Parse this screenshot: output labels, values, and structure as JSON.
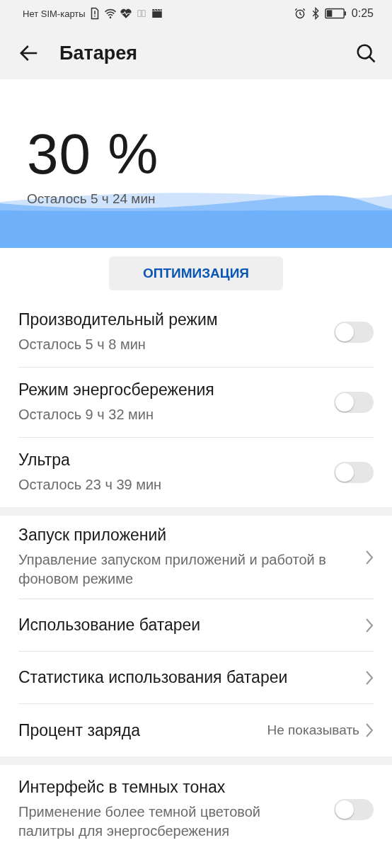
{
  "status_bar": {
    "carrier": "Нет SIM-карты",
    "time": "0:25"
  },
  "app_bar": {
    "title": "Батарея"
  },
  "battery": {
    "percent": "30 %",
    "remaining": "Осталось 5 ч 24 мин"
  },
  "optimize_button": "ОПТИМИЗАЦИЯ",
  "sections": [
    {
      "rows": [
        {
          "kind": "toggle",
          "title": "Производительный режим",
          "subtitle": "Осталось 5 ч 8 мин",
          "on": false
        },
        {
          "kind": "toggle",
          "title": "Режим энергосбережения",
          "subtitle": "Осталось 9 ч 32 мин",
          "on": false
        },
        {
          "kind": "toggle",
          "title": "Ультра",
          "subtitle": "Осталось 23 ч 39 мин",
          "on": false
        }
      ]
    },
    {
      "rows": [
        {
          "kind": "link",
          "title": "Запуск приложений",
          "subtitle": "Управление запуском приложений и работой в фоновом режиме"
        },
        {
          "kind": "link",
          "title": "Использование батареи"
        },
        {
          "kind": "link",
          "title": "Статистика использования батареи"
        },
        {
          "kind": "link",
          "title": "Процент заряда",
          "value": "Не показывать"
        }
      ]
    },
    {
      "rows": [
        {
          "kind": "toggle",
          "title": "Интерфейс в темных тонах",
          "subtitle": "Применение более темной цветовой палитры для энергосбережения",
          "on": false
        }
      ]
    }
  ]
}
